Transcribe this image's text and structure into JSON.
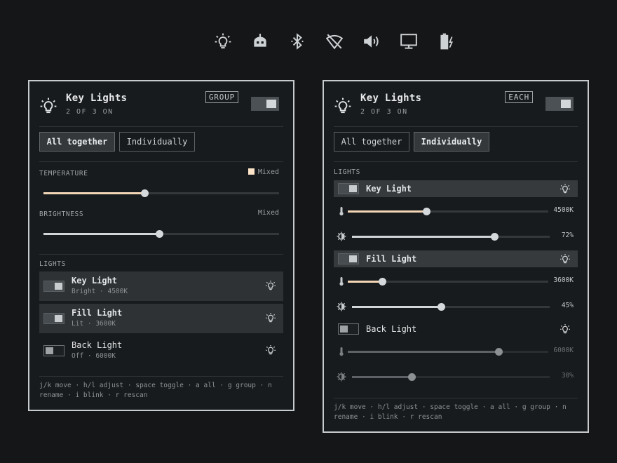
{
  "topbar": {
    "icons": [
      "lightbulb-icon",
      "robot-icon",
      "bluetooth-icon",
      "wifi-off-icon",
      "volume-icon",
      "display-icon",
      "battery-charging-icon"
    ]
  },
  "colors": {
    "warm": "#fbe4c8",
    "background": "#141618",
    "panel": "#181b1d"
  },
  "panel_group": {
    "title": "Key Lights",
    "subtitle": "2 OF 3 ON",
    "badge": "GROUP",
    "master_on": true,
    "modes": [
      "All together",
      "Individually"
    ],
    "active_mode": "All together",
    "temperature": {
      "label": "TEMPERATURE",
      "status": "Mixed",
      "level": 0.43
    },
    "brightness": {
      "label": "BRIGHTNESS",
      "status": "Mixed",
      "level": 0.49
    },
    "lights_label": "LIGHTS",
    "lights": [
      {
        "name": "Key Light",
        "desc": "Bright · 4500K",
        "on": true
      },
      {
        "name": "Fill Light",
        "desc": "Lit · 3600K",
        "on": true
      },
      {
        "name": "Back Light",
        "desc": "Off · 6000K",
        "on": false
      }
    ],
    "help": "j/k move · h/l adjust · space toggle · a all · g group · n rename · i blink · r rescan"
  },
  "panel_each": {
    "title": "Key Lights",
    "subtitle": "2 OF 3 ON",
    "badge": "EACH",
    "master_on": true,
    "modes": [
      "All together",
      "Individually"
    ],
    "active_mode": "Individually",
    "lights_label": "LIGHTS",
    "lights": [
      {
        "name": "Key Light",
        "on": true,
        "temp": "4500K",
        "temp_level": 0.39,
        "brightness": "72%",
        "brightness_level": 0.72
      },
      {
        "name": "Fill Light",
        "on": true,
        "temp": "3600K",
        "temp_level": 0.17,
        "brightness": "45%",
        "brightness_level": 0.45
      },
      {
        "name": "Back Light",
        "on": false,
        "temp": "6000K",
        "temp_level": 0.75,
        "brightness": "30%",
        "brightness_level": 0.3
      }
    ],
    "help": "j/k move · h/l adjust · space toggle · a all · g group · n rename · i blink · r rescan"
  }
}
